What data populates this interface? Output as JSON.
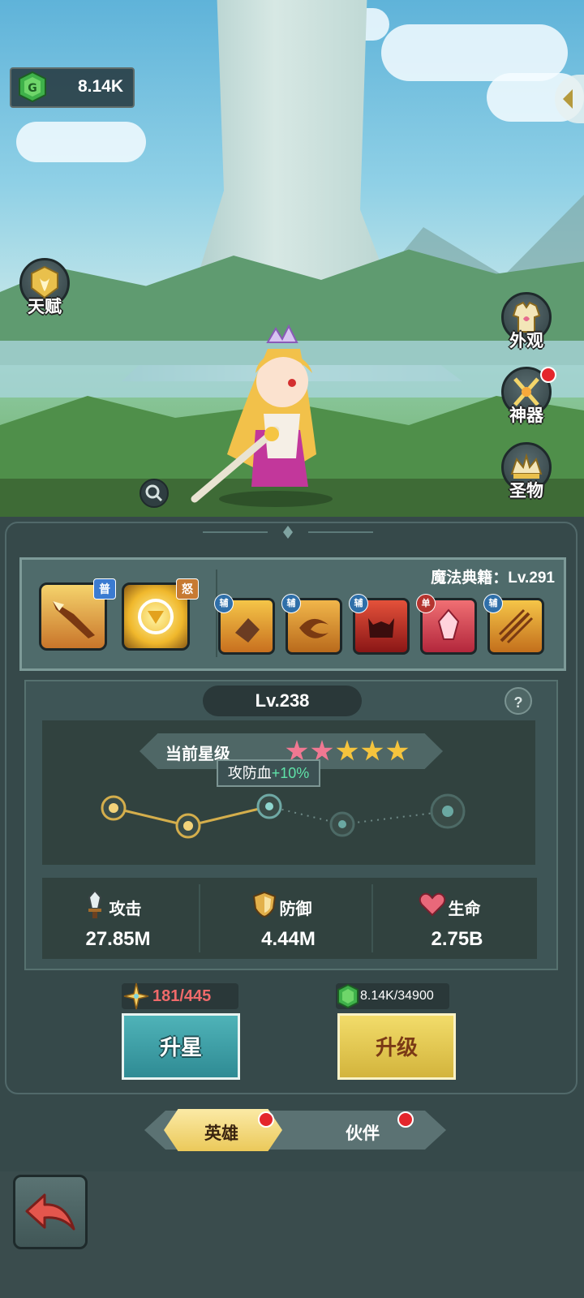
{
  "currency": {
    "amount": "8.14K",
    "icon": "green-gem-icon"
  },
  "side_buttons": {
    "talent": "天赋",
    "appearance": "外观",
    "artifact": "神器",
    "relic": "圣物"
  },
  "skills": {
    "title": "魔法典籍：Lv.291",
    "main": [
      {
        "tag": "普",
        "icon": "spear-skill-icon"
      },
      {
        "tag": "怒",
        "icon": "shield-burst-skill-icon"
      }
    ],
    "passives": [
      {
        "tag": "辅",
        "icon": "gauntlet-skill-icon"
      },
      {
        "tag": "辅",
        "icon": "whirlwind-skill-icon"
      },
      {
        "tag": "辅",
        "icon": "demon-skill-icon"
      },
      {
        "tag": "单",
        "icon": "crystal-skill-icon"
      },
      {
        "tag": "辅",
        "icon": "triple-spear-skill-icon"
      }
    ]
  },
  "level": "Lv.238",
  "help": "?",
  "star_rank": {
    "label": "当前星级",
    "filled": 2,
    "total": 5
  },
  "tooltip": {
    "prefix": "攻防血",
    "bonus": "+10%"
  },
  "stats": [
    {
      "label": "攻击",
      "value": "27.85M",
      "icon": "sword-icon"
    },
    {
      "label": "防御",
      "value": "4.44M",
      "icon": "shield-icon"
    },
    {
      "label": "生命",
      "value": "2.75B",
      "icon": "heart-icon"
    }
  ],
  "star_up": {
    "cost": "181/445",
    "label": "升星"
  },
  "level_up": {
    "cost": "8.14K/34900",
    "label": "升级"
  },
  "tabs": {
    "hero": "英雄",
    "partner": "伙伴"
  },
  "colors": {
    "accent_teal": "#3a9ea6",
    "accent_gold": "#e5c64c",
    "cost_red": "#ef6a6a",
    "bonus_green": "#5fe3a8"
  }
}
